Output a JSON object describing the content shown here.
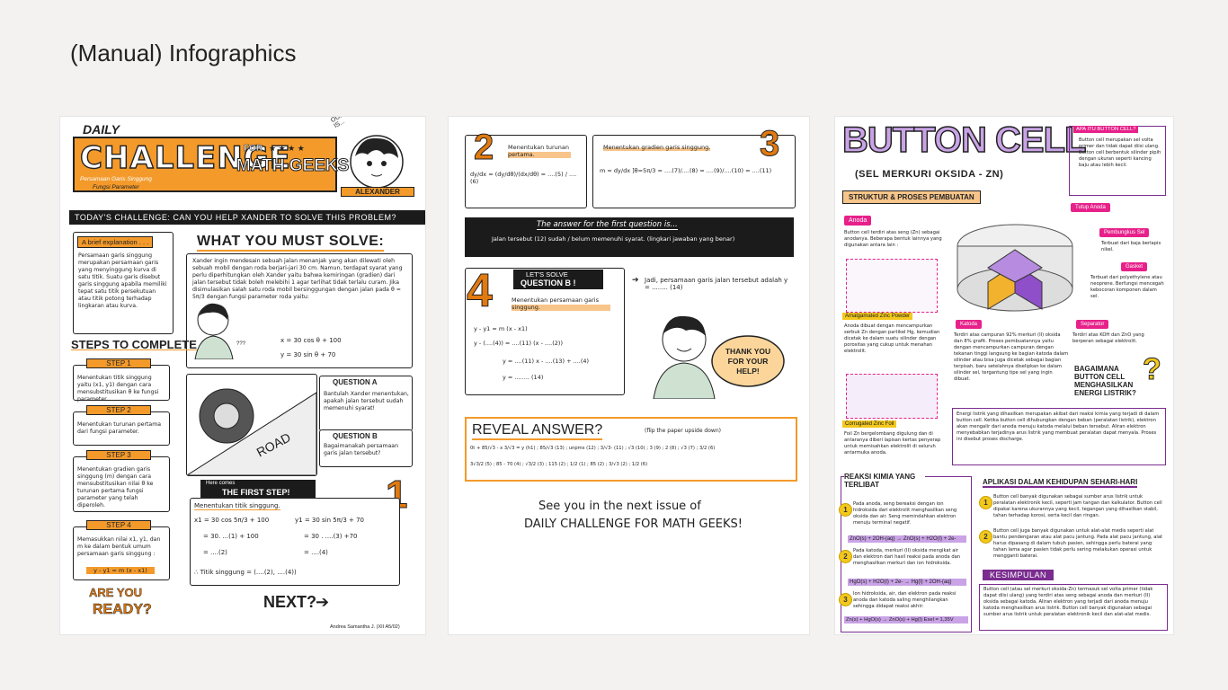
{
  "page": {
    "title": "(Manual) Infographics"
  },
  "panel1": {
    "daily": "DAILY",
    "challenge": "CHALLENGE",
    "for": "FOR",
    "stars": "★ ★ ★ ★",
    "math_geeks": "MATH GEEKS",
    "subtitle1": "Persamaan Garis Singgung",
    "subtitle2": "Fungsi Parameter",
    "main_char": "OUR MAIN CHARACTER TODAY IS...",
    "alexander": "ALEXANDER",
    "todays": "TODAY'S CHALLENGE: CAN YOU HELP XANDER TO SOLVE THIS PROBLEM?",
    "brief_title": "A brief explanation . . .",
    "brief_text": "Persamaan garis singgung merupakan persamaan garis yang menyinggung kurva di satu titik. Suatu garis disebut garis singgung apabila memiliki tepat satu titik persekutuan atau titik potong terhadap lingkaran atau kurva.",
    "solve_title": "WHAT YOU MUST SOLVE:",
    "solve_text": "Xander ingin mendesain sebuah jalan menanjak yang akan dilewati oleh sebuah mobil dengan roda berjari-jari 30 cm. Namun, terdapat syarat yang perlu diperhitungkan oleh Xander yaitu bahwa kemiringan (gradien) dari jalan tersebut tidak boleh melebihi 1 agar terlihat tidak terlalu curam. Jika disimulasikan salah satu roda mobil bersinggungan dengan jalan pada θ = 5π/3 dengan fungsi parameter roda yaitu:",
    "eq1": "x = 30 cos θ + 100",
    "eq2": "y = 30 sin θ + 70",
    "qmarks": "???",
    "road": "ROAD",
    "qa_title": "QUESTION A",
    "qa_text": "Bantulah Xander menentukan, apakah jalan tersebut sudah memenuhi syarat!",
    "qb_title": "QUESTION B",
    "qb_text": "Bagaimanakah persamaan garis jalan tersebut?",
    "steps_title": "STEPS TO COMPLETE",
    "steps": [
      {
        "label": "STEP 1",
        "text": "Menentukan titik singgung yaitu (x1, y1) dengan cara mensubstitusikan θ ke fungsi parameter."
      },
      {
        "label": "STEP 2",
        "text": "Menentukan turunan pertama dari fungsi parameter."
      },
      {
        "label": "STEP 3",
        "text": "Menentukan gradien garis singgung (m) dengan cara mensubstitusikan nilai θ ke turunan pertama fungsi parameter yang telah diperoleh."
      },
      {
        "label": "STEP 4",
        "text": "Memasukkan nilai x1, y1, dan m ke dalam bentuk umum persamaan garis singgung :",
        "formula": "y - y1 = m (x - x1)"
      }
    ],
    "are_you": "ARE YOU",
    "ready": "READY?",
    "here_comes": "Here comes",
    "first_step": "THE FIRST STEP!",
    "big1": "1",
    "titik_title": "Menentukan titik singgung.",
    "x_line1": "x1 = 30 cos 5π/3 + 100",
    "x_line2": "= 30. ...(1) + 100",
    "x_line3": "= ....(2)",
    "y_line1": "y1 = 30 sin 5π/3 + 70",
    "y_line2": "= 30 . ....(3) +70",
    "y_line3": "= ....(4)",
    "titik_result": "∴ Titik singgung = (....(2), ....(4))",
    "next": "NEXT?",
    "author": "Andrea Samantha J. (XII A5/02)"
  },
  "panel2": {
    "big2": "2",
    "turunan": "Menentukan turunan pertama.",
    "deriv_eq": "dy/dx = (dy/dθ)/(dx/dθ) = ....(5) / ....(6)",
    "big3": "3",
    "gradien": "Menentukan gradien garis singgung.",
    "grad_eq": "m = dy/dx ]θ=5π/3 = ....(7)/....(8) = ....(9)/....(10) = ....(11)",
    "answer_title": "The answer for the first question is...",
    "answer_text": "Jalan tersebut (12) sudah / belum memenuhi syarat. (lingkari jawaban yang benar)",
    "big4": "4",
    "lets_solve": "LET'S SOLVE",
    "question_b": "QUESTION B !",
    "persamaan": "Menentukan persamaan garis singgung.",
    "eq_a": "y - y1 = m (x - x1)",
    "eq_b": "y - (....(4)) = ....(11) (x - ....(2))",
    "eq_c": "y = ....(11) x - ....(13) + ....(4)",
    "eq_d": "y = ........ (14)",
    "jadi": "Jadi, persamaan garis jalan tersebut adalah y = ........ (14)",
    "thank_you": "THANK YOU FOR YOUR HELP!",
    "reveal": "REVEAL ANSWER?",
    "reveal_note": "(flip the paper upside down)",
    "reveal_line1": "0t + 85/√3 - x 3/√3 = y (h1) ; 85/√3 (13) ; unpms (12) ; 3/√3- (11) ; √3 (10) ; 3 (9) ; 2 (8) ; √3 (7) ; 3/2 (6)",
    "reveal_line2": "3√3/2 (5) ; 85 - 70 (4) ; √3/2 (3) ; 115 (2) ; 1/2 (1) ; 85 (2) ; 3/√3 (2) ; 1/2 (6)",
    "see_you": "See you in the next issue of",
    "daily_math": "DAILY CHALLENGE FOR MATH GEEKS!"
  },
  "panel3": {
    "title": "BUTTON CELL",
    "subtitle": "(SEL MERKURI OKSIDA - ZN)",
    "apa_title": "APA ITU BUTTON CELL?",
    "apa_text": "Button cell merupakan sel volta primer dan tidak dapat diisi ulang. Button cell berbentuk silinder pipih dengan ukuran seperti kancing baju atau lebih kecil.",
    "struktur": "STRUKTUR & PROSES PEMBUATAN",
    "anoda": "Anoda",
    "anoda_text": "Button cell terdiri atas seng (Zn) sebagai anodanya. Beberapa bentuk lainnya yang digunakan antara lain :",
    "tutup_anoda": "Tutup Anoda",
    "pembungkus": "Pembungkus Sel",
    "pembungkus_text": "Terbuat dari baja berlapis nikel.",
    "gasket": "Gasket",
    "gasket_text": "Terbuat dari polyethylene atau neoprene. Berfungsi mencegah kebocoran komponen dalam sel.",
    "amalgamated": "Amalgamated Zinc Powder",
    "amalgamated_text": "Anoda dibuat dengan mencampurkan serbuk Zn dengan partikel Hg, kemudian dicetak ke dalam suatu silinder dengan porositas yang cukup untuk menahan elektrolit.",
    "katoda": "Katoda",
    "katoda_text": "Terdiri atas campuran 92% merkuri (II) oksida dan 8% grafit. Proses pembuatannya yaitu dengan mencampurkan campuran dengan tekanan tinggi langsung ke bagian katoda dalam silinder atau bisa juga dicetak sebagai bagian terpisah, baru setelahnya diselipkan ke dalam silinder sel, tergantung tipe sel yang ingin dibuat.",
    "separator": "Separator",
    "separator_text": "Terdiri atas KOH dan ZnO yang berperan sebagai elektrolit.",
    "corrugated": "Corrugated Zinc Foil",
    "corrugated_text": "Foil Zn bergelombang digulung dan di antaranya diberi lapisan kertas penyerap untuk memisahkan elektrolit di seluruh antarmuka anoda.",
    "bagaimana": "BAGAIMANA BUTTON CELL MENGHASILKAN ENERGI LISTRIK?",
    "energi_text": "Energi listrik yang dihasilkan merupakan akibat dari reaksi kimia yang terjadi di dalam button cell. Ketika button cell dihubungkan dengan beban (peralatan listrik), elektron akan mengalir dari anoda menuju katoda melalui beban tersebut. Aliran elektron menyebabkan terjadinya arus listrik yang membuat peralatan dapat menyala. Proses ini disebut proses discharge.",
    "reaksi": "REAKSI KIMIA YANG TERLIBAT",
    "r1_text": "Pada anoda, seng bereaksi dengan ion hidroksida dari elektrolit menghasilkan seng oksida dan air. Seng memindahkan elektron menuju terminal negatif.",
    "r1_eq": "ZnO(s) + 2OH-(aq) → ZnO(s) + H2O(l) + 2e-",
    "r2_text": "Pada katoda, merkuri (II) oksida mengikat air dan elektron dari hasil reaksi pada anoda dan menghasilkan merkuri dan ion hidroksida.",
    "r2_eq": "HgO(s) + H2O(l) + 2e- → Hg(l) + 2OH-(aq)",
    "r3_text": "Ion hidroksida, air, dan elektron pada reaksi anoda dan katoda saling menghilangkan sehingga didapat reaksi akhir:",
    "r3_eq": "Zn(s) + HgO(s) → ZnO(s) + Hg(l)  Esel = 1,35V",
    "aplikasi": "APLIKASI DALAM KEHIDUPAN SEHARI-HARI",
    "ap1": "Button cell banyak digunakan sebagai sumber arus listrik untuk peralatan elektronik kecil, seperti jam tangan dan kalkulator. Button cell dipakai karena ukurannya yang kecil, tegangan yang dihasilkan stabil, tahan terhadap korosi, serta kecil dan ringan.",
    "ap2": "Button cell juga banyak digunakan untuk alat-alat medis seperti alat bantu pendengaran atau alat pacu jantung. Pada alat pacu jantung, alat harus dipasang di dalam tubuh pasien, sehingga perlu baterai yang tahan lama agar pasien tidak perlu sering melakukan operasi untuk mengganti baterai.",
    "kesimpulan": "KESIMPULAN",
    "kes_text": "Button cell (atau sel merkuri oksida-Zn) termasuk sel volta primer (tidak dapat diisi ulang) yang terdiri atas seng sebagai anoda dan merkuri (II) oksida sebagai katoda. Aliran elektron yang terjadi dari anoda menuju katoda menghasilkan arus listrik. Button cell banyak digunakan sebagai sumber arus listrik untuk peralatan elektronik kecil dan alat-alat medis."
  }
}
